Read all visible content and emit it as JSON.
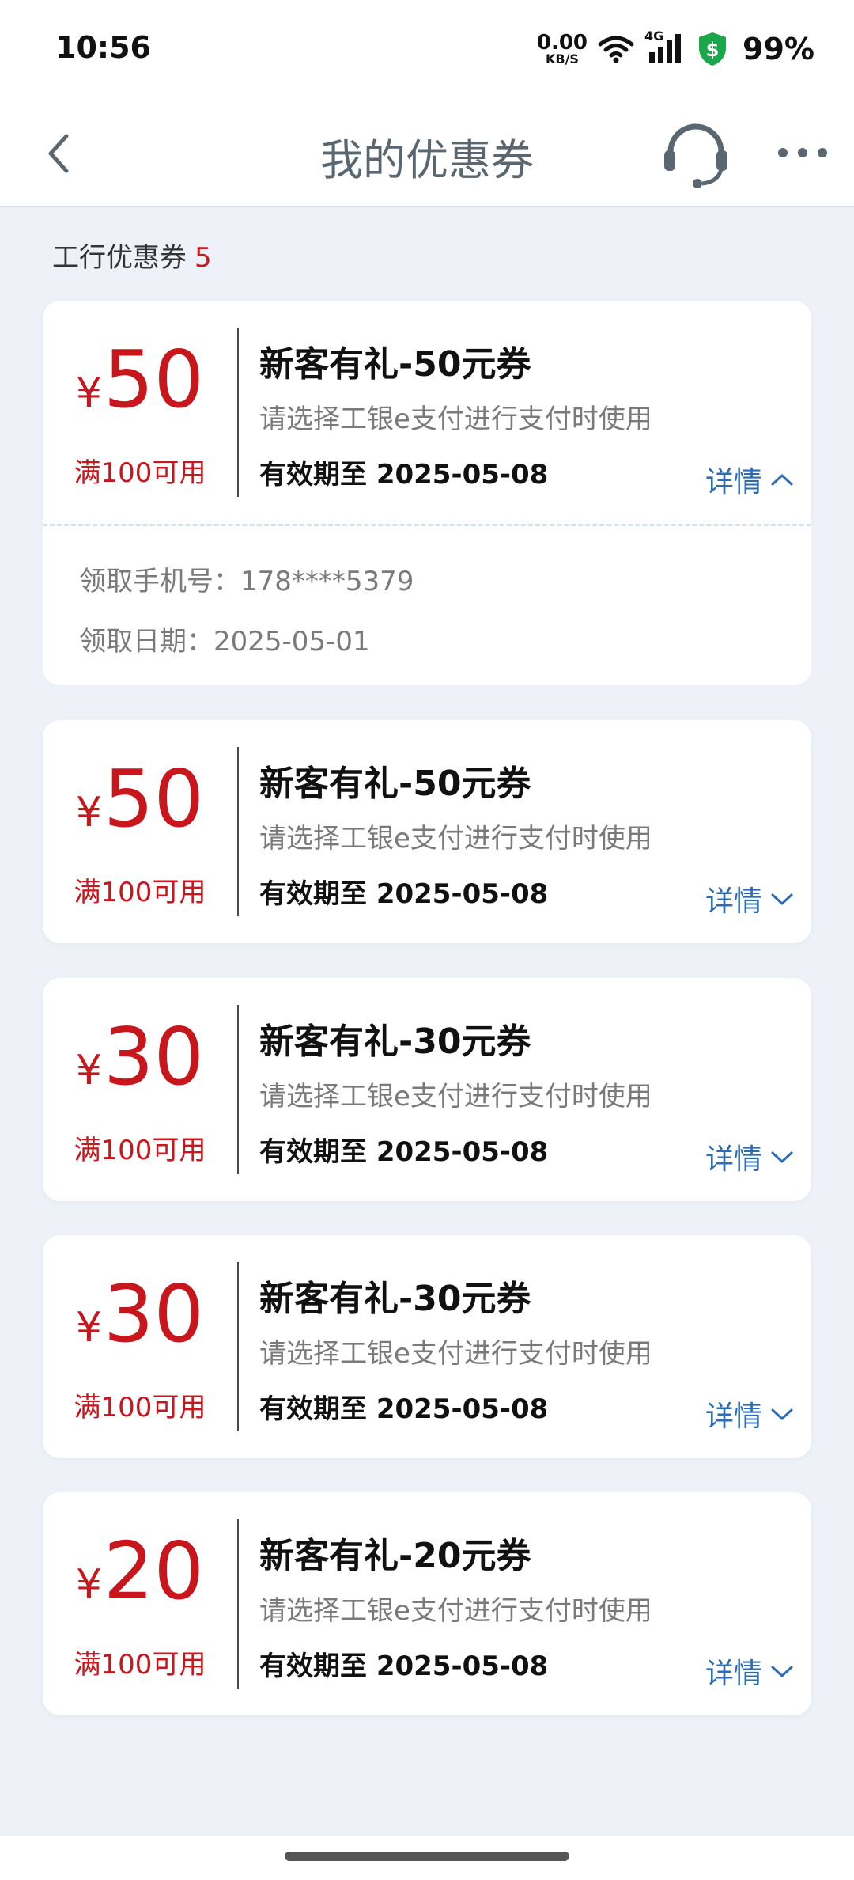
{
  "status_bar": {
    "time": "10:56",
    "speed_value": "0.00",
    "speed_unit": "KB/S",
    "network": "4G",
    "battery": "99%"
  },
  "nav": {
    "title": "我的优惠券"
  },
  "section": {
    "label": "工行优惠券",
    "count": "5"
  },
  "coupons": [
    {
      "currency": "¥",
      "amount": "50",
      "threshold": "满100可用",
      "title": "新客有礼-50元券",
      "desc": "请选择工银e支付进行支付时使用",
      "validity": "有效期至 2025-05-08",
      "details_label": "详情",
      "expanded": true
    },
    {
      "currency": "¥",
      "amount": "50",
      "threshold": "满100可用",
      "title": "新客有礼-50元券",
      "desc": "请选择工银e支付进行支付时使用",
      "validity": "有效期至 2025-05-08",
      "details_label": "详情",
      "expanded": false
    },
    {
      "currency": "¥",
      "amount": "30",
      "threshold": "满100可用",
      "title": "新客有礼-30元券",
      "desc": "请选择工银e支付进行支付时使用",
      "validity": "有效期至 2025-05-08",
      "details_label": "详情",
      "expanded": false
    },
    {
      "currency": "¥",
      "amount": "30",
      "threshold": "满100可用",
      "title": "新客有礼-30元券",
      "desc": "请选择工银e支付进行支付时使用",
      "validity": "有效期至 2025-05-08",
      "details_label": "详情",
      "expanded": false
    },
    {
      "currency": "¥",
      "amount": "20",
      "threshold": "满100可用",
      "title": "新客有礼-20元券",
      "desc": "请选择工银e支付进行支付时使用",
      "validity": "有效期至 2025-05-08",
      "details_label": "详情",
      "expanded": false
    }
  ],
  "expanded_details": {
    "phone_label": "领取手机号：",
    "phone_value": "178****5379",
    "date_label": "领取日期：",
    "date_value": "2025-05-01"
  },
  "colors": {
    "accent_red": "#c8161d",
    "link_blue": "#2c6cb6",
    "background": "#eef2f8",
    "shield_green": "#1aa64b"
  },
  "icons": {
    "back": "chevron-left-icon",
    "support": "headset-icon",
    "more": "more-dots-icon",
    "wifi": "wifi-icon",
    "signal": "signal-icon",
    "shield": "security-shield-icon"
  }
}
